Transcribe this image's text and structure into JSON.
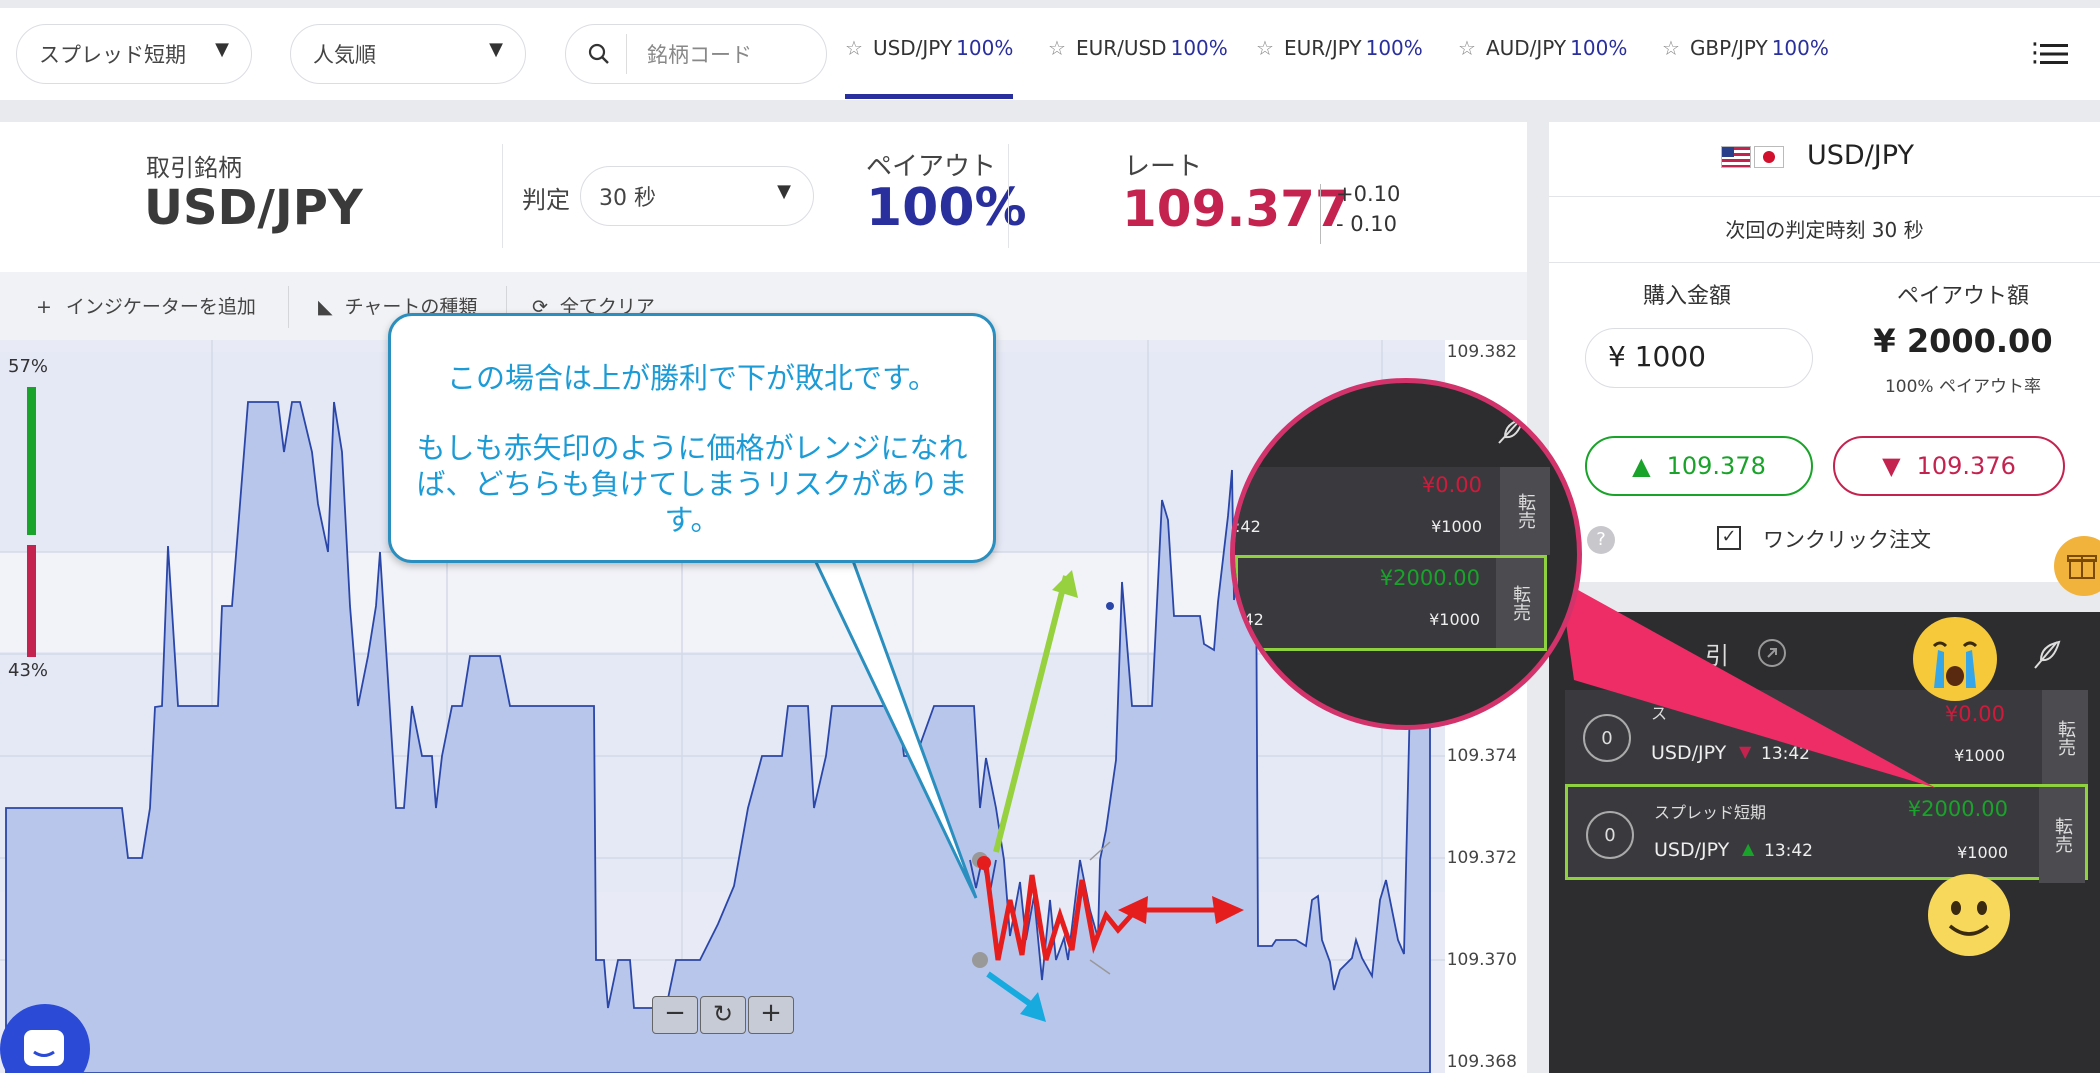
{
  "topbar": {
    "filter1": "スプレッド短期",
    "filter2": "人気順",
    "search_placeholder": "銘柄コード",
    "tabs": [
      {
        "pair": "USD/JPY",
        "pct": "100%"
      },
      {
        "pair": "EUR/USD",
        "pct": "100%"
      },
      {
        "pair": "EUR/JPY",
        "pct": "100%"
      },
      {
        "pair": "AUD/JPY",
        "pct": "100%"
      },
      {
        "pair": "GBP/JPY",
        "pct": "100%"
      }
    ]
  },
  "info": {
    "symbol_label": "取引銘柄",
    "symbol": "USD/JPY",
    "judge_label": "判定",
    "judge_value": "30 秒",
    "payout_label": "ペイアウト",
    "payout": "100%",
    "rate_label": "レート",
    "rate": "109.377",
    "rate_up": "+0.10",
    "rate_down": "- 0.10"
  },
  "toolbar": {
    "add_indicator": "インジケーターを追加",
    "chart_type": "チャートの種類",
    "clear_all": "全てクリア"
  },
  "chart": {
    "ratio_up": "57%",
    "ratio_down": "43%",
    "ratio_up_value": 0.57,
    "y_ticks": [
      "109.382",
      "109.374",
      "109.372",
      "109.370",
      "109.368"
    ]
  },
  "callout": {
    "line1": "この場合は上が勝利で下が敗北です。",
    "line2": "もしも赤矢印のように価格がレンジになれ",
    "line3": "ば、どちらも負けてしまうリスクがあります。"
  },
  "right_panel": {
    "pair": "USD/JPY",
    "next_judge": "次回の判定時刻 30 秒",
    "amount_label": "購入金額",
    "payout_amount_label": "ペイアウト額",
    "amount": "¥ 1000",
    "payout_amount": "¥ 2000.00",
    "payout_rate": "100% ペイアウト率",
    "high_button": "109.378",
    "low_button": "109.376",
    "one_click": "ワンクリック注文",
    "trade_header": "引",
    "trades": [
      {
        "count": "0",
        "name": "ス",
        "pair": "USD/JPY",
        "time": "13:42",
        "profit": "¥0.00",
        "amount": "¥1000",
        "resell": "転売"
      },
      {
        "count": "0",
        "name": "スプレッド短期",
        "pair": "USD/JPY",
        "time": "13:42",
        "profit": "¥2000.00",
        "amount": "¥1000",
        "resell": "転売"
      }
    ]
  },
  "magnifier": {
    "row1_profit": "¥0.00",
    "row1_time": ":42",
    "row1_amount": "¥1000",
    "row2_profit": "¥2000.00",
    "row2_time": ":42",
    "row2_amount": "¥1000",
    "resell": "転売"
  },
  "colors": {
    "accent": "#2a2f9e",
    "rate_red": "#c4234f",
    "high_green": "#1aa32a",
    "low_red": "#c4234f",
    "callout_blue": "#1c9bd6",
    "magnifier_border": "#d2336a"
  }
}
